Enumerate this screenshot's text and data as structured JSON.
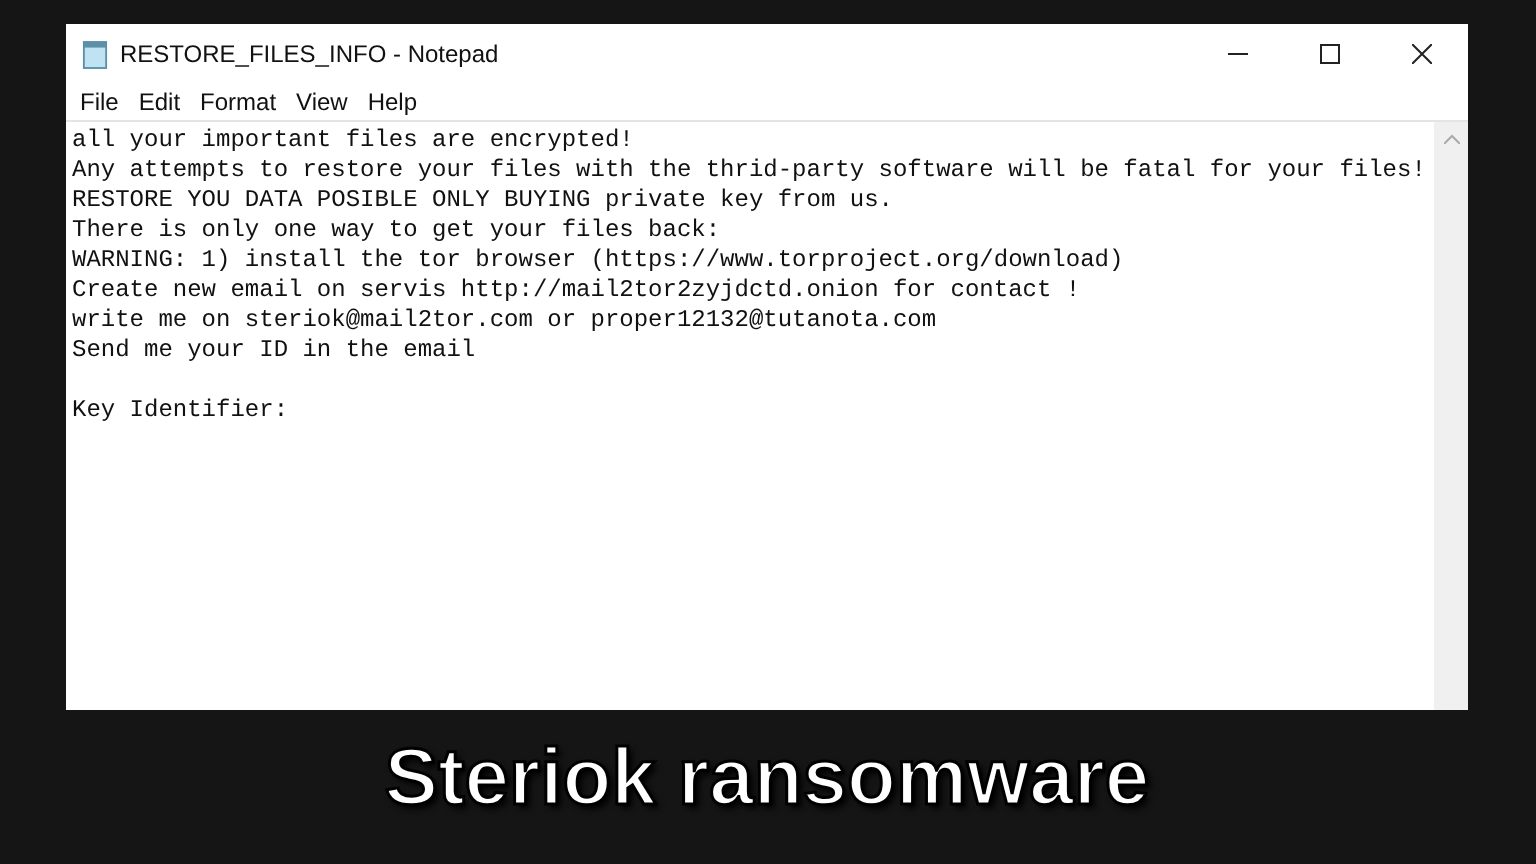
{
  "window": {
    "title": "RESTORE_FILES_INFO - Notepad"
  },
  "menu": [
    "File",
    "Edit",
    "Format",
    "View",
    "Help"
  ],
  "editor": {
    "paragraphs": [
      [
        "all your important files are encrypted!",
        "Any attempts to restore your files with the thrid-party software will be fatal for your files!",
        "RESTORE YOU DATA POSIBLE ONLY BUYING private key from us.",
        "There is only one way to get your files back:",
        "WARNING: 1) install the tor browser (https://www.torproject.org/download)",
        "Create new email on servis http://mail2tor2zyjdctd.onion for contact !",
        "write me on steriok@mail2tor.com or proper12132@tutanota.com",
        "Send me your ID in the email"
      ],
      [
        "Key Identifier:"
      ]
    ]
  },
  "caption": "Steriok ransomware"
}
